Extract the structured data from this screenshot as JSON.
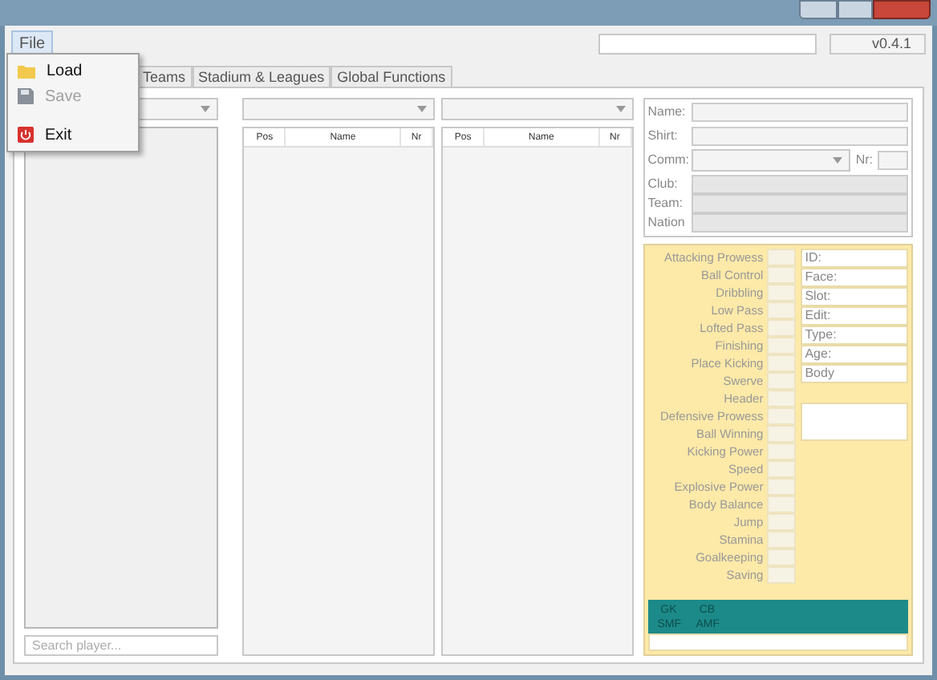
{
  "menu": [
    {
      "label": "File",
      "open": true
    }
  ],
  "file_menu": [
    {
      "label": "Load",
      "disabled": false,
      "kind": "load"
    },
    {
      "label": "Save",
      "disabled": true,
      "kind": "save"
    },
    {
      "label": "Exit",
      "disabled": false,
      "kind": "exit"
    }
  ],
  "version": "v0.4.1",
  "tabs": [
    {
      "label": "Teams",
      "selected": false
    },
    {
      "label": "Stadium & Leagues",
      "selected": false
    },
    {
      "label": "Global Functions",
      "selected": false
    }
  ],
  "player_search": {
    "placeholder": "Search player..."
  },
  "squad_lists": [
    {
      "columns": [
        "Pos",
        "Name",
        "Nr"
      ]
    },
    {
      "columns": [
        "Pos",
        "Name",
        "Nr"
      ]
    }
  ],
  "player_info": {
    "name_label": "Name:",
    "shirt_label": "Shirt:",
    "comm_label": "Comm:",
    "nr_label": "Nr:",
    "club_label": "Club:",
    "team_label": "Team:",
    "nation_label": "Nation"
  },
  "stats": [
    "Attacking Prowess",
    "Ball Control",
    "Dribbling",
    "Low Pass",
    "Lofted Pass",
    "Finishing",
    "Place Kicking",
    "Swerve",
    "Header",
    "Defensive Prowess",
    "Ball Winning",
    "Kicking Power",
    "Speed",
    "Explosive Power",
    "Body Balance",
    "Jump",
    "Stamina",
    "Goalkeeping",
    "Saving"
  ],
  "details": [
    "ID:",
    "Face:",
    "Slot:",
    "Edit:",
    "Type:",
    "Age:",
    "Body"
  ],
  "positions": [
    [
      "GK",
      "CB"
    ],
    [
      "SMF",
      "AMF"
    ]
  ]
}
